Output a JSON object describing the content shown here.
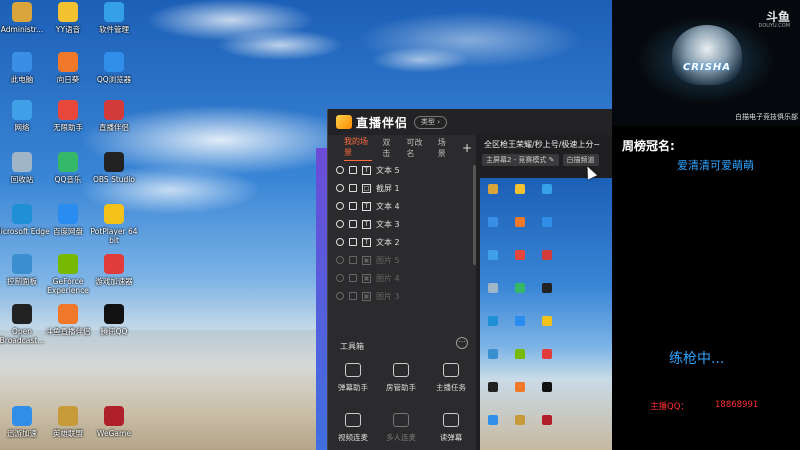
{
  "desktop": {
    "icons": [
      {
        "label": "Administr...",
        "icon": "user-folder-icon",
        "color": "#d9a43a"
      },
      {
        "label": "YY语音",
        "icon": "yy-voice-icon",
        "color": "#f2c230"
      },
      {
        "label": "软件管理",
        "icon": "software-manager-icon",
        "color": "#35a0e8"
      },
      {
        "label": "此电脑",
        "icon": "this-pc-icon",
        "color": "#3a8ee6"
      },
      {
        "label": "向日葵",
        "icon": "sunflower-icon",
        "color": "#f07828"
      },
      {
        "label": "QQ浏览器",
        "icon": "qq-browser-icon",
        "color": "#2f8fe8"
      },
      {
        "label": "网络",
        "icon": "network-icon",
        "color": "#3fa0e8"
      },
      {
        "label": "无限助手",
        "icon": "game-assistant-icon",
        "color": "#e8473b"
      },
      {
        "label": "直播伴侣",
        "icon": "stream-companion-icon",
        "color": "#d33a3a"
      },
      {
        "label": "回收站",
        "icon": "recycle-bin-icon",
        "color": "#9fb6c9"
      },
      {
        "label": "QQ音乐",
        "icon": "qq-music-icon",
        "color": "#35b86a"
      },
      {
        "label": "OBS Studio",
        "icon": "obs-icon",
        "color": "#222222"
      },
      {
        "label": "Microsoft Edge",
        "icon": "edge-icon",
        "color": "#1f8fd6"
      },
      {
        "label": "百度网盘",
        "icon": "baidu-pan-icon",
        "color": "#2a8cf0"
      },
      {
        "label": "PotPlayer 64 bit",
        "icon": "potplayer-icon",
        "color": "#f2c21a"
      },
      {
        "label": "控制面板",
        "icon": "control-panel-icon",
        "color": "#3a8fd0"
      },
      {
        "label": "GeForce Experience",
        "icon": "geforce-icon",
        "color": "#76b900"
      },
      {
        "label": "游戏加速器",
        "icon": "accelerator-icon",
        "color": "#e23b3b"
      },
      {
        "label": "Open Broadcast...",
        "icon": "obs-shortcut-icon",
        "color": "#222222"
      },
      {
        "label": "斗鱼直播伴侣",
        "icon": "douyu-companion-icon",
        "color": "#f07828"
      },
      {
        "label": "腾讯QQ",
        "icon": "qq-icon",
        "color": "#111111"
      },
      {
        "label": "迅游加速",
        "icon": "xunyou-icon",
        "color": "#2f8fe8"
      },
      {
        "label": "英雄联盟",
        "icon": "lol-icon",
        "color": "#c79a3a"
      },
      {
        "label": "WeGame",
        "icon": "wegame-icon",
        "color": "#b0202a"
      }
    ]
  },
  "app": {
    "title": "直播伴侣",
    "pill": "类型 ›",
    "tabs": [
      "我的场景",
      "双击",
      "可改名",
      "场景"
    ],
    "add_label": "+",
    "sources": [
      {
        "label": "文本 5",
        "type": "T",
        "dim": false
      },
      {
        "label": "截屏 1",
        "type": "□",
        "dim": false
      },
      {
        "label": "文本 4",
        "type": "T",
        "dim": false
      },
      {
        "label": "文本 3",
        "type": "T",
        "dim": false
      },
      {
        "label": "文本 2",
        "type": "T",
        "dim": false
      },
      {
        "label": "图片 5",
        "type": "▣",
        "dim": true
      },
      {
        "label": "图片 4",
        "type": "▣",
        "dim": true
      },
      {
        "label": "图片 3",
        "type": "▣",
        "dim": true
      }
    ],
    "toolbox_label": "工具箱",
    "toolbox_more": "···",
    "tools": [
      {
        "label": "弹幕助手",
        "dim": false
      },
      {
        "label": "房管助手",
        "dim": false
      },
      {
        "label": "主播任务",
        "dim": false
      },
      {
        "label": "视频连麦",
        "dim": false
      },
      {
        "label": "多人连麦",
        "dim": true
      },
      {
        "label": "读弹幕",
        "dim": false
      }
    ],
    "preview_title": "全区枪王荣耀/秒上号/极速上分~",
    "preview_chips": [
      "主屏幕2 - 竞赛模式 ✎",
      "白描频道"
    ]
  },
  "overlay": {
    "douyu_badge": "斗鱼",
    "douyu_url": "DOUYU.COM",
    "cam_logo_text": "CRISHA",
    "cam_caption": "白描电子竞技俱乐部",
    "crown_label": "周榜冠名:",
    "crown_name": "爱清清可爱萌萌",
    "practice_text": "练枪中...",
    "qq_label": "主播QQ：",
    "qq_number": "18868991"
  },
  "colors": {
    "accent_orange": "#ff6b3d",
    "overlay_blue": "#2ea3ff",
    "qq_red": "#ff3030"
  }
}
